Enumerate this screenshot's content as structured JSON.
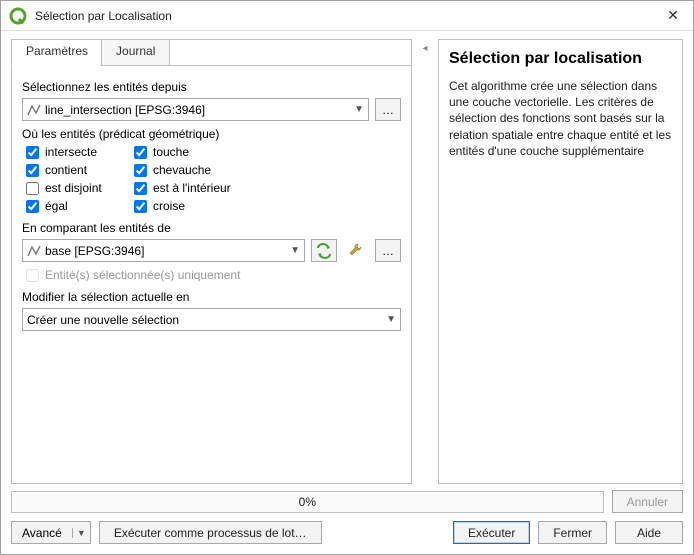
{
  "window": {
    "title": "Sélection par Localisation"
  },
  "tabs": {
    "parameters": "Paramètres",
    "log": "Journal"
  },
  "labels": {
    "select_from": "Sélectionnez les entités depuis",
    "predicate": "Où les entités (prédicat géométrique)",
    "compare_from": "En comparant les entités de",
    "selected_only": "Entité(s) sélectionnée(s) uniquement",
    "modify": "Modifier la sélection actuelle en"
  },
  "layers": {
    "select_from_value": "line_intersection [EPSG:3946]",
    "compare_from_value": "base [EPSG:3946]"
  },
  "predicates": {
    "intersects": {
      "label": "intersecte",
      "checked": true
    },
    "contains": {
      "label": "contient",
      "checked": true
    },
    "disjoint": {
      "label": "est disjoint",
      "checked": false
    },
    "equals": {
      "label": "égal",
      "checked": true
    },
    "touches": {
      "label": "touche",
      "checked": true
    },
    "overlaps": {
      "label": "chevauche",
      "checked": true
    },
    "within": {
      "label": "est à l'intérieur",
      "checked": true
    },
    "crosses": {
      "label": "croise",
      "checked": true
    }
  },
  "modify_value": "Créer une nouvelle sélection",
  "help": {
    "title": "Sélection par localisation",
    "text": "Cet algorithme crée une sélection dans une couche vectorielle. Les critères de sélection des fonctions sont basés sur la relation spatiale entre chaque entité et les entités d'une couche supplémentaire"
  },
  "progress": {
    "text": "0%"
  },
  "buttons": {
    "cancel": "Annuler",
    "advanced": "Avancé",
    "batch": "Exécuter comme processus de lot…",
    "run": "Exécuter",
    "close": "Fermer",
    "help_btn": "Aide",
    "more": "…"
  },
  "colors": {
    "accent": "#5aa02c"
  }
}
